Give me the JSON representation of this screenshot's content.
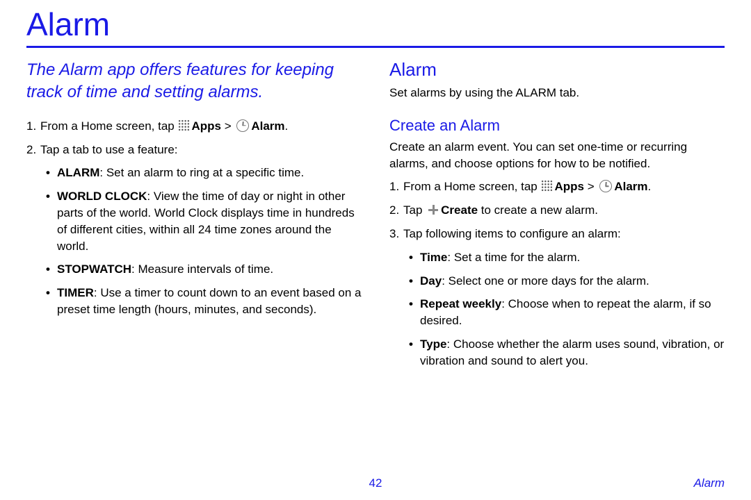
{
  "pageTitle": "Alarm",
  "intro": "The Alarm app offers features for keeping track of time and setting alarms.",
  "leftSteps": {
    "s1_a": "From a Home screen, tap ",
    "s1_apps": "Apps",
    "s1_gt": " > ",
    "s1_alarm": "Alarm",
    "s1_end": ".",
    "s2": "Tap a tab to use a feature:"
  },
  "tabs": {
    "alarm_b": "ALARM",
    "alarm_t": ": Set an alarm to ring at a specific time.",
    "world_b": "WORLD CLOCK",
    "world_t": ": View the time of day or night in other parts of the world. World Clock displays time in hundreds of different cities, within all 24 time zones around the world.",
    "stop_b": "STOPWATCH",
    "stop_t": ": Measure intervals of time.",
    "timer_b": "TIMER",
    "timer_t": ": Use a timer to count down to an event based on a preset time length (hours, minutes, and seconds)."
  },
  "right": {
    "h2": "Alarm",
    "desc": "Set alarms by using the ALARM tab.",
    "h3": "Create an Alarm",
    "create_desc": "Create an alarm event. You can set one-time or recurring alarms, and choose options for how to be notified."
  },
  "rightSteps": {
    "s1_a": "From a Home screen, tap ",
    "s1_apps": "Apps",
    "s1_gt": " > ",
    "s1_alarm": "Alarm",
    "s1_end": ".",
    "s2_a": "Tap ",
    "s2_create": "Create",
    "s2_b": " to create a new alarm.",
    "s3": "Tap following items to configure an alarm:"
  },
  "config": {
    "time_b": "Time",
    "time_t": ": Set a time for the alarm.",
    "day_b": "Day",
    "day_t": ": Select one or more days for the alarm.",
    "repeat_b": "Repeat weekly",
    "repeat_t": ": Choose when to repeat the alarm, if so desired.",
    "type_b": "Type",
    "type_t": ": Choose whether the alarm uses sound, vibration, or vibration and sound to alert you."
  },
  "footer": {
    "pageNumber": "42",
    "sectionLabel": "Alarm"
  }
}
